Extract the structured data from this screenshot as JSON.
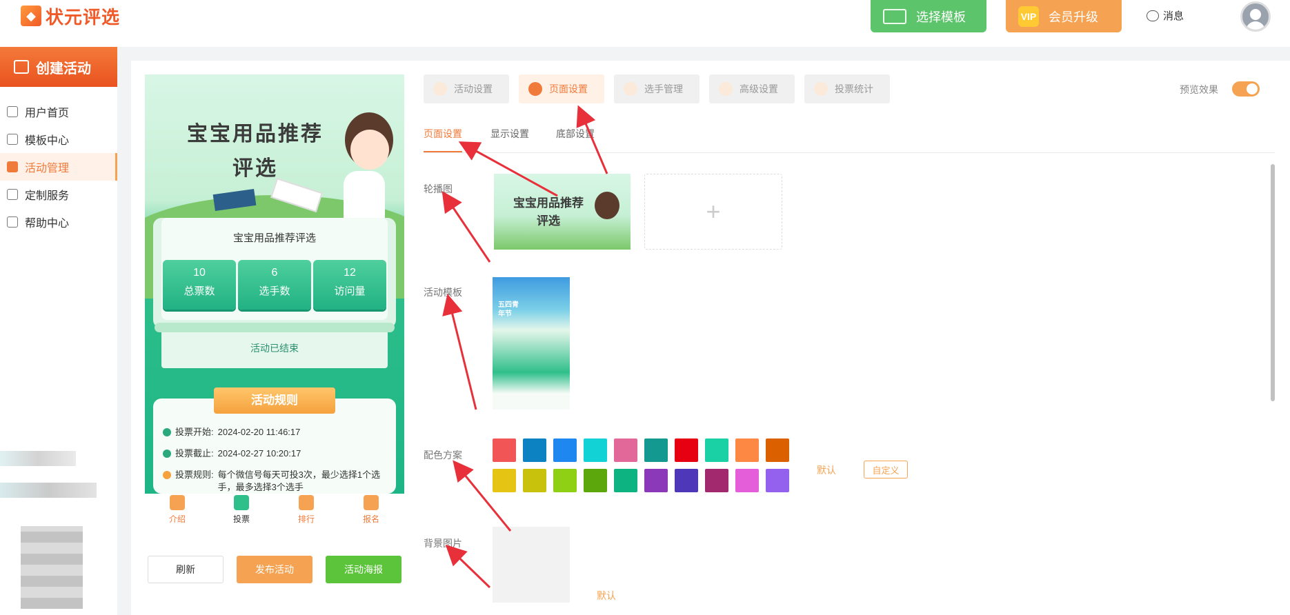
{
  "header": {
    "logo_text": "状元评选",
    "template_btn": "选择模板",
    "vip_badge": "VIP",
    "vip_btn": "会员升级",
    "messages": "消息"
  },
  "sidebar": {
    "create": "创建活动",
    "items": [
      {
        "label": "用户首页",
        "icon": "home-icon"
      },
      {
        "label": "模板中心",
        "icon": "template-icon"
      },
      {
        "label": "活动管理",
        "icon": "ticket-icon"
      },
      {
        "label": "定制服务",
        "icon": "tools-icon"
      },
      {
        "label": "帮助中心",
        "icon": "help-icon"
      }
    ],
    "active_index": 2
  },
  "preview": {
    "title": "宝宝用品推荐评选",
    "subtitle": "宝宝用品推荐评选",
    "stats": [
      {
        "value": "10",
        "label": "总票数"
      },
      {
        "value": "6",
        "label": "选手数"
      },
      {
        "value": "12",
        "label": "访问量"
      }
    ],
    "status": "活动已结束",
    "rules_title": "活动规则",
    "rules": [
      {
        "label": "投票开始:",
        "value": "2024-02-20 11:46:17"
      },
      {
        "label": "投票截止:",
        "value": "2024-02-27 10:20:17"
      },
      {
        "label": "投票规则:",
        "value": "每个微信号每天可投3次，最少选择1个选手，最多选择3个选手"
      }
    ],
    "tabs": [
      "介绍",
      "投票",
      "排行",
      "报名"
    ]
  },
  "actions": {
    "refresh": "刷新",
    "publish": "发布活动",
    "poster": "活动海报"
  },
  "top_tabs": [
    "活动设置",
    "页面设置",
    "选手管理",
    "高级设置",
    "投票统计"
  ],
  "top_tab_active": 1,
  "preview_toggle_label": "预览效果",
  "sub_tabs": [
    "页面设置",
    "显示设置",
    "底部设置"
  ],
  "sections": {
    "carousel": "轮播图",
    "carousel_banner_text": "宝宝用品推荐评选",
    "add_symbol": "+",
    "template": "活动模板",
    "template_thumb_text": "五四青年节",
    "color_scheme": "配色方案",
    "color_default": "默认",
    "color_custom": "自定义",
    "background": "背景图片",
    "background_default": "默认"
  },
  "colors": [
    "#f25555",
    "#0c82c2",
    "#1e87f0",
    "#13d2d6",
    "#e3689a",
    "#13998f",
    "#e60012",
    "#1ad1a5",
    "#fd8843",
    "#db6100",
    "#e6c413",
    "#c9c20c",
    "#8fd014",
    "#5ca80c",
    "#0db380",
    "#8b39b8",
    "#4e37b8",
    "#a3296f",
    "#e45ed9",
    "#9460ee"
  ]
}
